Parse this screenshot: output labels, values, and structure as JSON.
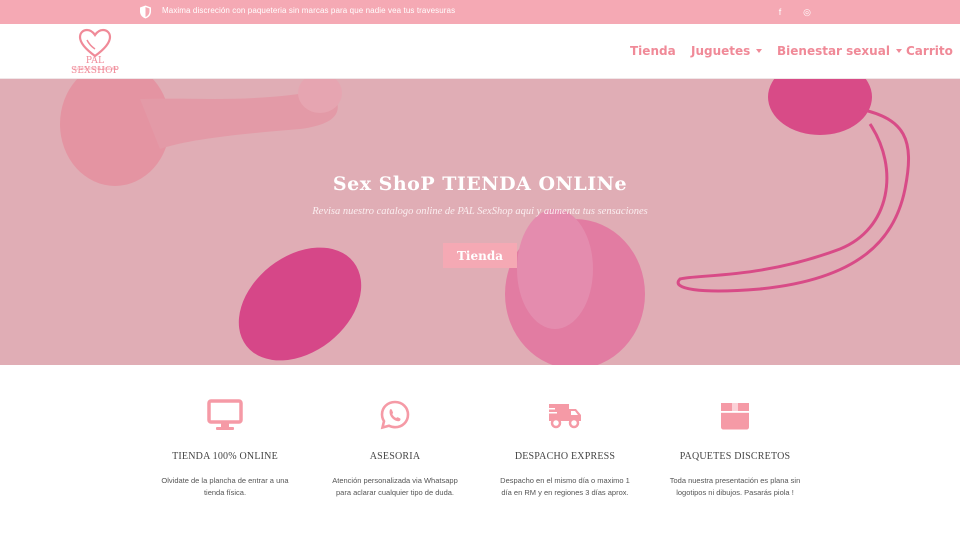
{
  "topbar": {
    "message": "Maxima discreción con paqueteria sin marcas para que nadie vea tus travesuras",
    "icons": [
      "shield-icon",
      "facebook-icon",
      "instagram-icon"
    ],
    "facebook_glyph": "f",
    "instagram_glyph": "◎"
  },
  "header": {
    "logo_name": "PAL SEXSHOP",
    "logo_tagline": "TU JUGUETERIA SEGURA",
    "nav": [
      {
        "label": "Tienda"
      },
      {
        "label": "Juguetes"
      },
      {
        "label": "Bienestar sexual"
      },
      {
        "label": "Carrito"
      }
    ]
  },
  "hero": {
    "title": "Sex ShoP TIENDA ONLINe",
    "subtitle": "Revisa nuestro catalogo online de PAL SexShop aqui y aumenta tus sensaciones",
    "button": "Tienda"
  },
  "features": [
    {
      "title": "TIENDA 100% ONLINE",
      "desc": "Olvidate de la plancha de entrar a una tienda física.",
      "icon": "monitor-icon"
    },
    {
      "title": "ASESORIA",
      "desc": "Atención personalizada via Whatsapp para aclarar cualquier tipo de duda.",
      "icon": "whatsapp-icon"
    },
    {
      "title": "DESPACHO EXPRESS",
      "desc": "Despacho en el mismo día o maximo 1 día en RM y en regiones 3 días aprox.",
      "icon": "truck-icon"
    },
    {
      "title": "PAQUETES DISCRETOS",
      "desc": "Toda nuestra presentación es plana sin logotipos ni dibujos. Pasarás piola !",
      "icon": "box-icon"
    }
  ],
  "colors": {
    "accent": "#f5a9b4",
    "nav_text": "#f08a98",
    "icon": "#f59aa6"
  }
}
